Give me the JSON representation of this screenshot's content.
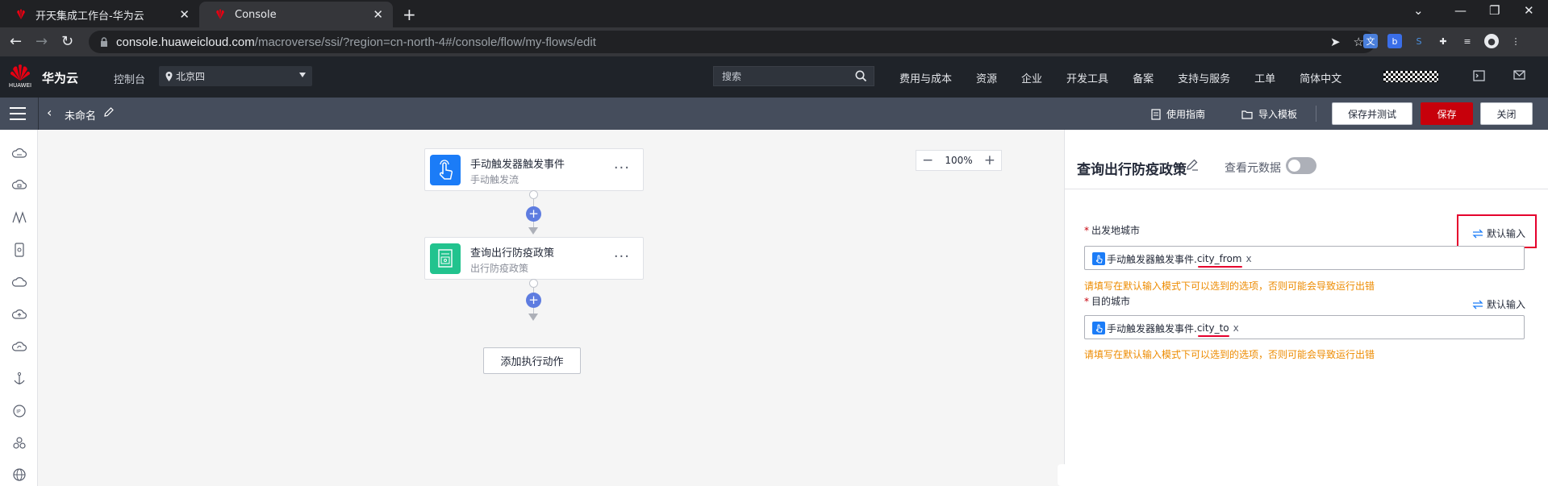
{
  "browser": {
    "tabs": [
      {
        "label": "开天集成工作台-华为云",
        "active": false
      },
      {
        "label": "Console",
        "active": true
      }
    ],
    "url_host": "console.huaweicloud.com",
    "url_path": "/macroverse/ssi/?region=cn-north-4#/console/flow/my-flows/edit"
  },
  "topnav": {
    "logo_text": "HUAWEI",
    "brand": "华为云",
    "console": "控制台",
    "region": "北京四",
    "search_placeholder": "搜索",
    "links": [
      "费用与成本",
      "资源",
      "企业",
      "开发工具",
      "备案",
      "支持与服务",
      "工单",
      "简体中文"
    ]
  },
  "flowbar": {
    "title": "未命名",
    "guide": "使用指南",
    "import_template": "导入模板",
    "save_and_test": "保存并测试",
    "save": "保存",
    "close": "关闭"
  },
  "canvas": {
    "zoom": "100%",
    "nodes": [
      {
        "title": "手动触发器触发事件",
        "subtitle": "手动触发流",
        "color": "#1b7cf7"
      },
      {
        "title": "查询出行防疫政策",
        "subtitle": "出行防疫政策",
        "color": "#22c38e"
      }
    ],
    "add_action": "添加执行动作"
  },
  "panel": {
    "title": "查询出行防疫政策",
    "view_metadata": "查看元数据",
    "fields": [
      {
        "label": "出发地城市",
        "default_input": "默认输入",
        "chip_source": "手动触发器触发事件.",
        "chip_var": "city_from",
        "chip_remove": "x",
        "hint": "请填写在默认输入模式下可以选到的选项，否则可能会导致运行出错"
      },
      {
        "label": "目的城市",
        "default_input": "默认输入",
        "chip_source": "手动触发器触发事件.",
        "chip_var": "city_to",
        "chip_remove": "x",
        "hint": "请填写在默认输入模式下可以选到的选项，否则可能会导致运行出错"
      }
    ]
  },
  "colors": {
    "brand_red": "#c7000b",
    "accent_blue": "#5e7ce0",
    "highlight_red": "#e5002d",
    "warning_orange": "#ed8b00"
  }
}
